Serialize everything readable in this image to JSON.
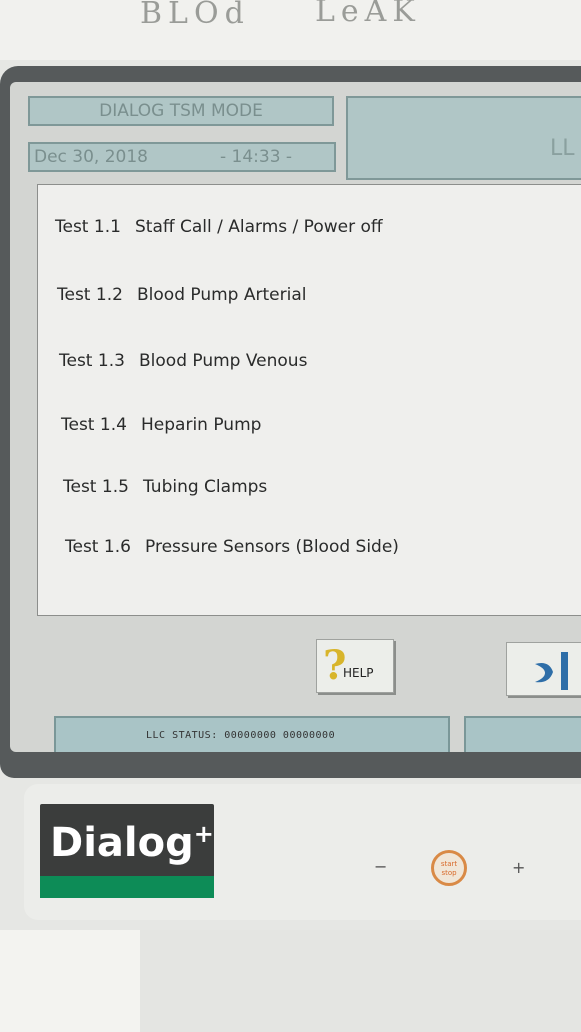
{
  "handwritten_note": [
    "BLOd",
    "LeAK"
  ],
  "header": {
    "mode_title": "DIALOG TSM MODE",
    "date": "Dec 30, 2018",
    "time": "- 14:33 -",
    "right_label": "LL"
  },
  "tests": [
    {
      "number": "Test 1.1",
      "label": "Staff Call / Alarms / Power off"
    },
    {
      "number": "Test 1.2",
      "label": "Blood Pump Arterial"
    },
    {
      "number": "Test 1.3",
      "label": "Blood Pump Venous"
    },
    {
      "number": "Test 1.4",
      "label": "Heparin Pump"
    },
    {
      "number": "Test 1.5",
      "label": "Tubing Clamps"
    },
    {
      "number": "Test 1.6",
      "label": "Pressure Sensors (Blood Side)"
    }
  ],
  "buttons": {
    "help_label": "HELP",
    "next_icon": "next-arrow-icon"
  },
  "status": {
    "text": "LLC STATUS: 00000000 00000000"
  },
  "device": {
    "brand": "Dialog",
    "brand_suffix": "+",
    "minus_label": "−",
    "plus_label": "+",
    "start_stop_label_1": "start",
    "start_stop_label_2": "stop"
  },
  "colors": {
    "header_teal": "#b0c6c6",
    "brand_green": "#0d8c57",
    "help_yellow": "#d8b52b",
    "start_orange": "#d98a46"
  }
}
